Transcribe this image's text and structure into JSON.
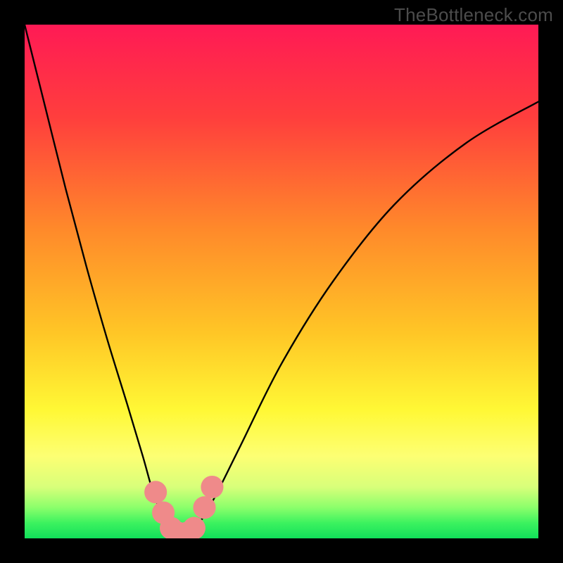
{
  "watermark": "TheBottleneck.com",
  "chart_data": {
    "type": "line",
    "title": "",
    "xlabel": "",
    "ylabel": "",
    "xlim": [
      0,
      100
    ],
    "ylim": [
      0,
      100
    ],
    "gradient_stops": [
      {
        "offset": 0,
        "color": "#ff1a55"
      },
      {
        "offset": 18,
        "color": "#ff3e3d"
      },
      {
        "offset": 40,
        "color": "#ff8a2a"
      },
      {
        "offset": 60,
        "color": "#ffc626"
      },
      {
        "offset": 75,
        "color": "#fff835"
      },
      {
        "offset": 84,
        "color": "#fdff73"
      },
      {
        "offset": 90,
        "color": "#d8ff7a"
      },
      {
        "offset": 94,
        "color": "#8bff6b"
      },
      {
        "offset": 97,
        "color": "#3cf25f"
      },
      {
        "offset": 100,
        "color": "#11e05a"
      }
    ],
    "series": [
      {
        "name": "bottleneck-curve",
        "x": [
          0,
          4,
          8,
          12,
          16,
          20,
          23,
          25,
          27,
          28.5,
          30,
          32,
          34,
          37,
          42,
          50,
          60,
          72,
          86,
          100
        ],
        "y": [
          100,
          84,
          68,
          53,
          39,
          26,
          16,
          9,
          4,
          1,
          0.5,
          1,
          3,
          8,
          18,
          34,
          50,
          65,
          77,
          85
        ]
      }
    ],
    "markers": {
      "name": "highlighted-points",
      "color": "#ef8a8a",
      "radius": 2.2,
      "points": [
        {
          "x": 25.5,
          "y": 9
        },
        {
          "x": 27.0,
          "y": 5
        },
        {
          "x": 28.5,
          "y": 2
        },
        {
          "x": 30.0,
          "y": 1
        },
        {
          "x": 31.5,
          "y": 1
        },
        {
          "x": 33.0,
          "y": 2
        },
        {
          "x": 35.0,
          "y": 6
        },
        {
          "x": 36.5,
          "y": 10
        }
      ]
    }
  }
}
